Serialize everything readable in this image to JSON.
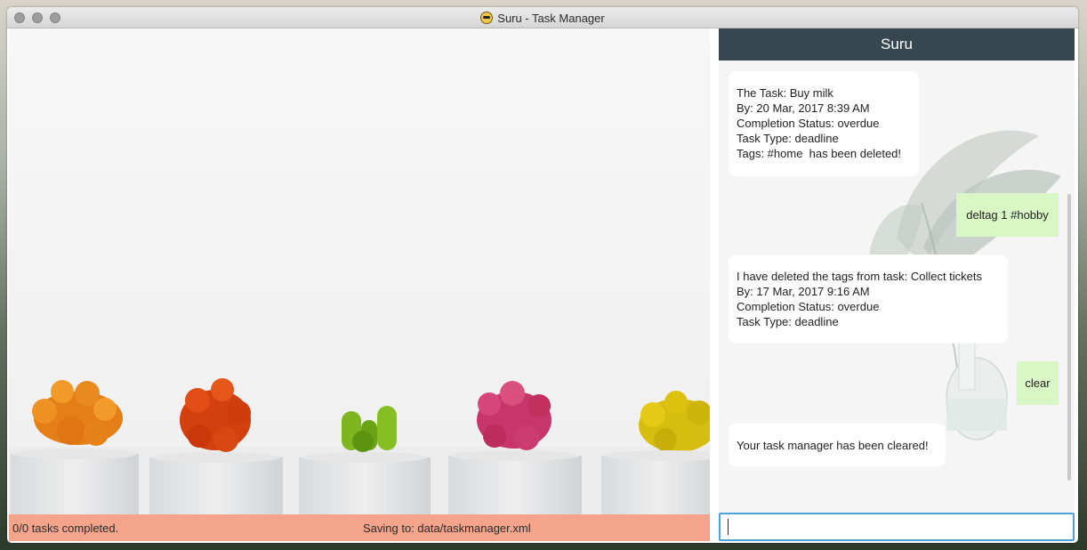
{
  "window": {
    "title": "Suru - Task Manager",
    "app_icon": "sunglasses-app-icon"
  },
  "status_bar": {
    "completed_text": "0/0 tasks completed.",
    "saving_text": "Saving to: data/taskmanager.xml",
    "color": "#f4a48b"
  },
  "chat": {
    "header_title": "Suru",
    "header_color": "#37474f",
    "messages": [
      {
        "sender": "bot",
        "text": "The Task: Buy milk\nBy: 20 Mar, 2017 8:39 AM\nCompletion Status: overdue\nTask Type: deadline\nTags: #home  has been deleted!"
      },
      {
        "sender": "user",
        "text": "deltag 1 #hobby"
      },
      {
        "sender": "bot",
        "text": "I have deleted the tags from task: Collect tickets\nBy: 17 Mar, 2017 9:16 AM\nCompletion Status: overdue\nTask Type: deadline"
      },
      {
        "sender": "user",
        "text": "clear"
      },
      {
        "sender": "bot",
        "text": "Your task manager has been cleared!"
      }
    ],
    "user_bubble_color": "#d9f7c4",
    "input": {
      "value": "",
      "placeholder": ""
    }
  }
}
